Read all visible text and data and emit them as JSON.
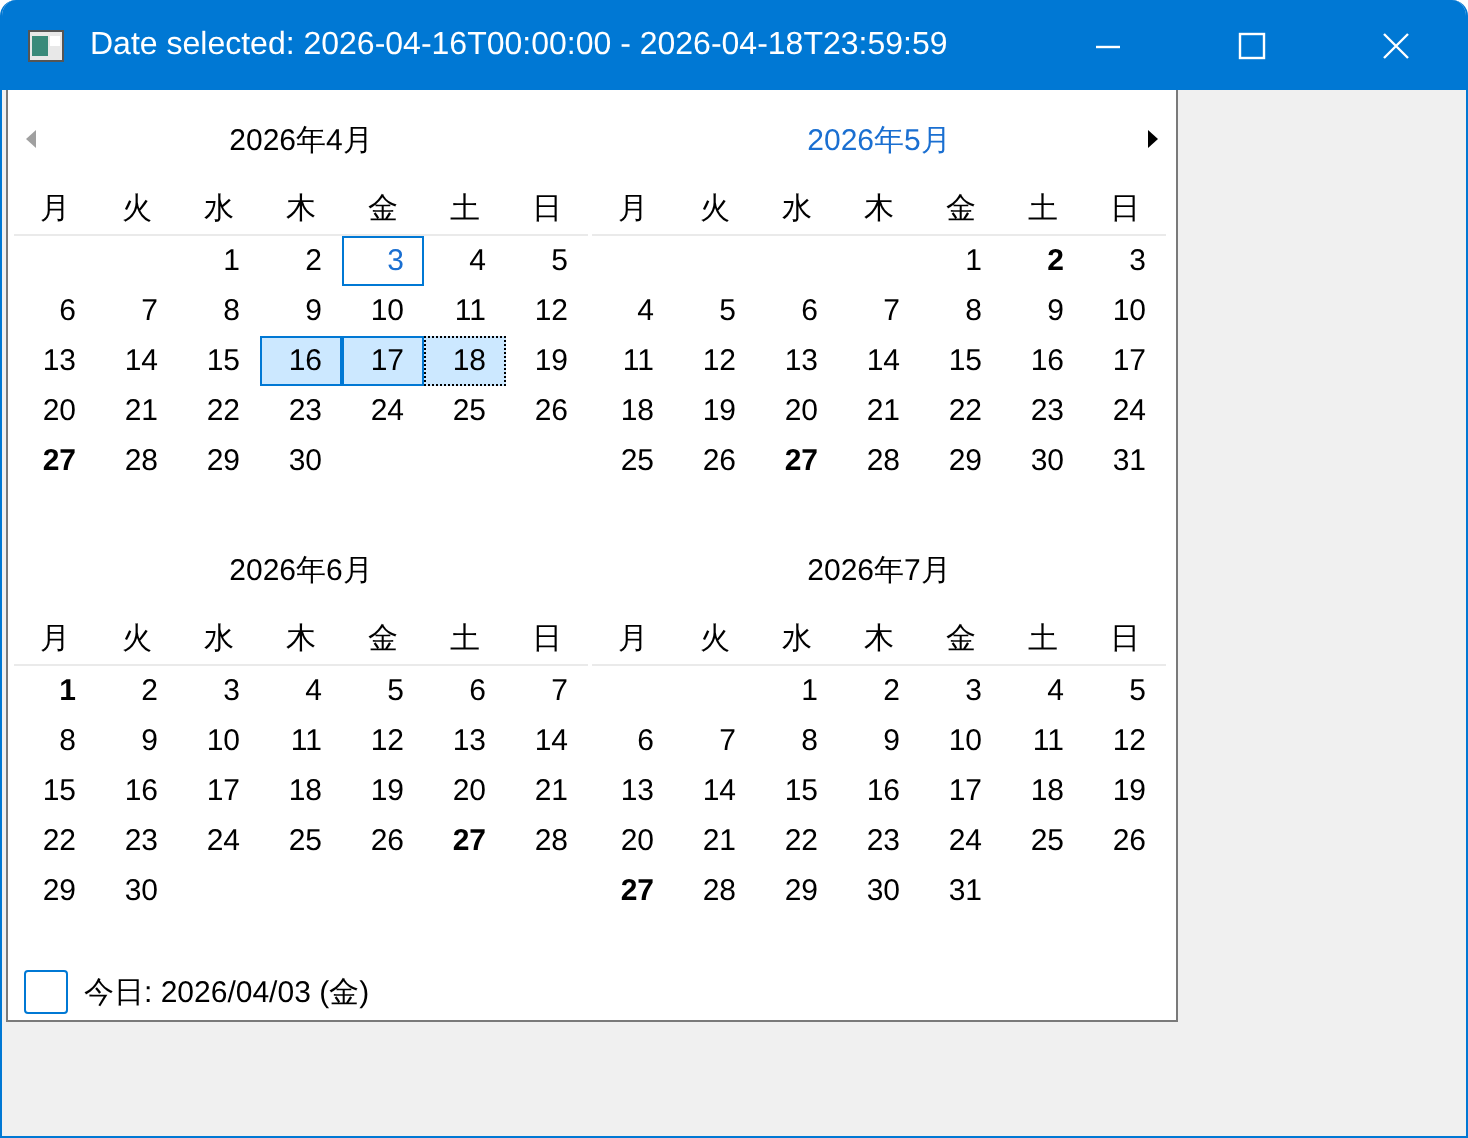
{
  "window": {
    "title": "Date selected: 2026-04-16T00:00:00 - 2026-04-18T23:59:59"
  },
  "months": [
    {
      "title": "2026年4月",
      "highlighted": false,
      "weekdays": [
        "月",
        "火",
        "水",
        "木",
        "金",
        "土",
        "日"
      ],
      "weeks": [
        {
          "kind": "leading",
          "days": [
            {
              "label": "1",
              "bold": false,
              "today": false,
              "selected": false,
              "focused": false
            },
            {
              "label": "2",
              "bold": false,
              "today": false,
              "selected": false,
              "focused": false
            },
            {
              "label": "3",
              "bold": false,
              "today": true,
              "selected": false,
              "focused": false
            },
            {
              "label": "4",
              "bold": false,
              "today": false,
              "selected": false,
              "focused": false
            },
            {
              "label": "5",
              "bold": false,
              "today": false,
              "selected": false,
              "focused": false
            }
          ]
        },
        {
          "kind": "full",
          "days": [
            {
              "label": "6",
              "bold": false,
              "today": false,
              "selected": false,
              "focused": false
            },
            {
              "label": "7",
              "bold": false,
              "today": false,
              "selected": false,
              "focused": false
            },
            {
              "label": "8",
              "bold": false,
              "today": false,
              "selected": false,
              "focused": false
            },
            {
              "label": "9",
              "bold": false,
              "today": false,
              "selected": false,
              "focused": false
            },
            {
              "label": "10",
              "bold": false,
              "today": false,
              "selected": false,
              "focused": false
            },
            {
              "label": "11",
              "bold": false,
              "today": false,
              "selected": false,
              "focused": false
            },
            {
              "label": "12",
              "bold": false,
              "today": false,
              "selected": false,
              "focused": false
            }
          ]
        },
        {
          "kind": "full",
          "days": [
            {
              "label": "13",
              "bold": false,
              "today": false,
              "selected": false,
              "focused": false
            },
            {
              "label": "14",
              "bold": false,
              "today": false,
              "selected": false,
              "focused": false
            },
            {
              "label": "15",
              "bold": false,
              "today": false,
              "selected": false,
              "focused": false
            },
            {
              "label": "16",
              "bold": false,
              "today": false,
              "selected": true,
              "focused": false
            },
            {
              "label": "17",
              "bold": false,
              "today": false,
              "selected": true,
              "focused": false
            },
            {
              "label": "18",
              "bold": false,
              "today": false,
              "selected": true,
              "focused": true
            },
            {
              "label": "19",
              "bold": false,
              "today": false,
              "selected": false,
              "focused": false
            }
          ]
        },
        {
          "kind": "full",
          "days": [
            {
              "label": "20",
              "bold": false,
              "today": false,
              "selected": false,
              "focused": false
            },
            {
              "label": "21",
              "bold": false,
              "today": false,
              "selected": false,
              "focused": false
            },
            {
              "label": "22",
              "bold": false,
              "today": false,
              "selected": false,
              "focused": false
            },
            {
              "label": "23",
              "bold": false,
              "today": false,
              "selected": false,
              "focused": false
            },
            {
              "label": "24",
              "bold": false,
              "today": false,
              "selected": false,
              "focused": false
            },
            {
              "label": "25",
              "bold": false,
              "today": false,
              "selected": false,
              "focused": false
            },
            {
              "label": "26",
              "bold": false,
              "today": false,
              "selected": false,
              "focused": false
            }
          ]
        },
        {
          "kind": "full",
          "days": [
            {
              "label": "27",
              "bold": true,
              "today": false,
              "selected": false,
              "focused": false
            },
            {
              "label": "28",
              "bold": false,
              "today": false,
              "selected": false,
              "focused": false
            },
            {
              "label": "29",
              "bold": false,
              "today": false,
              "selected": false,
              "focused": false
            },
            {
              "label": "30",
              "bold": false,
              "today": false,
              "selected": false,
              "focused": false
            }
          ]
        }
      ]
    },
    {
      "title": "2026年5月",
      "highlighted": true,
      "weekdays": [
        "月",
        "火",
        "水",
        "木",
        "金",
        "土",
        "日"
      ],
      "weeks": [
        {
          "kind": "leading",
          "days": [
            {
              "label": "1",
              "bold": false,
              "today": false,
              "selected": false,
              "focused": false
            },
            {
              "label": "2",
              "bold": true,
              "today": false,
              "selected": false,
              "focused": false
            },
            {
              "label": "3",
              "bold": false,
              "today": false,
              "selected": false,
              "focused": false
            }
          ]
        },
        {
          "kind": "full",
          "days": [
            {
              "label": "4",
              "bold": false,
              "today": false,
              "selected": false,
              "focused": false
            },
            {
              "label": "5",
              "bold": false,
              "today": false,
              "selected": false,
              "focused": false
            },
            {
              "label": "6",
              "bold": false,
              "today": false,
              "selected": false,
              "focused": false
            },
            {
              "label": "7",
              "bold": false,
              "today": false,
              "selected": false,
              "focused": false
            },
            {
              "label": "8",
              "bold": false,
              "today": false,
              "selected": false,
              "focused": false
            },
            {
              "label": "9",
              "bold": false,
              "today": false,
              "selected": false,
              "focused": false
            },
            {
              "label": "10",
              "bold": false,
              "today": false,
              "selected": false,
              "focused": false
            }
          ]
        },
        {
          "kind": "full",
          "days": [
            {
              "label": "11",
              "bold": false,
              "today": false,
              "selected": false,
              "focused": false
            },
            {
              "label": "12",
              "bold": false,
              "today": false,
              "selected": false,
              "focused": false
            },
            {
              "label": "13",
              "bold": false,
              "today": false,
              "selected": false,
              "focused": false
            },
            {
              "label": "14",
              "bold": false,
              "today": false,
              "selected": false,
              "focused": false
            },
            {
              "label": "15",
              "bold": false,
              "today": false,
              "selected": false,
              "focused": false
            },
            {
              "label": "16",
              "bold": false,
              "today": false,
              "selected": false,
              "focused": false
            },
            {
              "label": "17",
              "bold": false,
              "today": false,
              "selected": false,
              "focused": false
            }
          ]
        },
        {
          "kind": "full",
          "days": [
            {
              "label": "18",
              "bold": false,
              "today": false,
              "selected": false,
              "focused": false
            },
            {
              "label": "19",
              "bold": false,
              "today": false,
              "selected": false,
              "focused": false
            },
            {
              "label": "20",
              "bold": false,
              "today": false,
              "selected": false,
              "focused": false
            },
            {
              "label": "21",
              "bold": false,
              "today": false,
              "selected": false,
              "focused": false
            },
            {
              "label": "22",
              "bold": false,
              "today": false,
              "selected": false,
              "focused": false
            },
            {
              "label": "23",
              "bold": false,
              "today": false,
              "selected": false,
              "focused": false
            },
            {
              "label": "24",
              "bold": false,
              "today": false,
              "selected": false,
              "focused": false
            }
          ]
        },
        {
          "kind": "full",
          "days": [
            {
              "label": "25",
              "bold": false,
              "today": false,
              "selected": false,
              "focused": false
            },
            {
              "label": "26",
              "bold": false,
              "today": false,
              "selected": false,
              "focused": false
            },
            {
              "label": "27",
              "bold": true,
              "today": false,
              "selected": false,
              "focused": false
            },
            {
              "label": "28",
              "bold": false,
              "today": false,
              "selected": false,
              "focused": false
            },
            {
              "label": "29",
              "bold": false,
              "today": false,
              "selected": false,
              "focused": false
            },
            {
              "label": "30",
              "bold": false,
              "today": false,
              "selected": false,
              "focused": false
            },
            {
              "label": "31",
              "bold": false,
              "today": false,
              "selected": false,
              "focused": false
            }
          ]
        }
      ]
    },
    {
      "title": "2026年6月",
      "highlighted": false,
      "weekdays": [
        "月",
        "火",
        "水",
        "木",
        "金",
        "土",
        "日"
      ],
      "weeks": [
        {
          "kind": "full",
          "days": [
            {
              "label": "1",
              "bold": true,
              "today": false,
              "selected": false,
              "focused": false
            },
            {
              "label": "2",
              "bold": false,
              "today": false,
              "selected": false,
              "focused": false
            },
            {
              "label": "3",
              "bold": false,
              "today": false,
              "selected": false,
              "focused": false
            },
            {
              "label": "4",
              "bold": false,
              "today": false,
              "selected": false,
              "focused": false
            },
            {
              "label": "5",
              "bold": false,
              "today": false,
              "selected": false,
              "focused": false
            },
            {
              "label": "6",
              "bold": false,
              "today": false,
              "selected": false,
              "focused": false
            },
            {
              "label": "7",
              "bold": false,
              "today": false,
              "selected": false,
              "focused": false
            }
          ]
        },
        {
          "kind": "full",
          "days": [
            {
              "label": "8",
              "bold": false,
              "today": false,
              "selected": false,
              "focused": false
            },
            {
              "label": "9",
              "bold": false,
              "today": false,
              "selected": false,
              "focused": false
            },
            {
              "label": "10",
              "bold": false,
              "today": false,
              "selected": false,
              "focused": false
            },
            {
              "label": "11",
              "bold": false,
              "today": false,
              "selected": false,
              "focused": false
            },
            {
              "label": "12",
              "bold": false,
              "today": false,
              "selected": false,
              "focused": false
            },
            {
              "label": "13",
              "bold": false,
              "today": false,
              "selected": false,
              "focused": false
            },
            {
              "label": "14",
              "bold": false,
              "today": false,
              "selected": false,
              "focused": false
            }
          ]
        },
        {
          "kind": "full",
          "days": [
            {
              "label": "15",
              "bold": false,
              "today": false,
              "selected": false,
              "focused": false
            },
            {
              "label": "16",
              "bold": false,
              "today": false,
              "selected": false,
              "focused": false
            },
            {
              "label": "17",
              "bold": false,
              "today": false,
              "selected": false,
              "focused": false
            },
            {
              "label": "18",
              "bold": false,
              "today": false,
              "selected": false,
              "focused": false
            },
            {
              "label": "19",
              "bold": false,
              "today": false,
              "selected": false,
              "focused": false
            },
            {
              "label": "20",
              "bold": false,
              "today": false,
              "selected": false,
              "focused": false
            },
            {
              "label": "21",
              "bold": false,
              "today": false,
              "selected": false,
              "focused": false
            }
          ]
        },
        {
          "kind": "full",
          "days": [
            {
              "label": "22",
              "bold": false,
              "today": false,
              "selected": false,
              "focused": false
            },
            {
              "label": "23",
              "bold": false,
              "today": false,
              "selected": false,
              "focused": false
            },
            {
              "label": "24",
              "bold": false,
              "today": false,
              "selected": false,
              "focused": false
            },
            {
              "label": "25",
              "bold": false,
              "today": false,
              "selected": false,
              "focused": false
            },
            {
              "label": "26",
              "bold": false,
              "today": false,
              "selected": false,
              "focused": false
            },
            {
              "label": "27",
              "bold": true,
              "today": false,
              "selected": false,
              "focused": false
            },
            {
              "label": "28",
              "bold": false,
              "today": false,
              "selected": false,
              "focused": false
            }
          ]
        },
        {
          "kind": "full",
          "days": [
            {
              "label": "29",
              "bold": false,
              "today": false,
              "selected": false,
              "focused": false
            },
            {
              "label": "30",
              "bold": false,
              "today": false,
              "selected": false,
              "focused": false
            }
          ]
        }
      ]
    },
    {
      "title": "2026年7月",
      "highlighted": false,
      "weekdays": [
        "月",
        "火",
        "水",
        "木",
        "金",
        "土",
        "日"
      ],
      "weeks": [
        {
          "kind": "leading",
          "days": [
            {
              "label": "1",
              "bold": false,
              "today": false,
              "selected": false,
              "focused": false
            },
            {
              "label": "2",
              "bold": false,
              "today": false,
              "selected": false,
              "focused": false
            },
            {
              "label": "3",
              "bold": false,
              "today": false,
              "selected": false,
              "focused": false
            },
            {
              "label": "4",
              "bold": false,
              "today": false,
              "selected": false,
              "focused": false
            },
            {
              "label": "5",
              "bold": false,
              "today": false,
              "selected": false,
              "focused": false
            }
          ]
        },
        {
          "kind": "full",
          "days": [
            {
              "label": "6",
              "bold": false,
              "today": false,
              "selected": false,
              "focused": false
            },
            {
              "label": "7",
              "bold": false,
              "today": false,
              "selected": false,
              "focused": false
            },
            {
              "label": "8",
              "bold": false,
              "today": false,
              "selected": false,
              "focused": false
            },
            {
              "label": "9",
              "bold": false,
              "today": false,
              "selected": false,
              "focused": false
            },
            {
              "label": "10",
              "bold": false,
              "today": false,
              "selected": false,
              "focused": false
            },
            {
              "label": "11",
              "bold": false,
              "today": false,
              "selected": false,
              "focused": false
            },
            {
              "label": "12",
              "bold": false,
              "today": false,
              "selected": false,
              "focused": false
            }
          ]
        },
        {
          "kind": "full",
          "days": [
            {
              "label": "13",
              "bold": false,
              "today": false,
              "selected": false,
              "focused": false
            },
            {
              "label": "14",
              "bold": false,
              "today": false,
              "selected": false,
              "focused": false
            },
            {
              "label": "15",
              "bold": false,
              "today": false,
              "selected": false,
              "focused": false
            },
            {
              "label": "16",
              "bold": false,
              "today": false,
              "selected": false,
              "focused": false
            },
            {
              "label": "17",
              "bold": false,
              "today": false,
              "selected": false,
              "focused": false
            },
            {
              "label": "18",
              "bold": false,
              "today": false,
              "selected": false,
              "focused": false
            },
            {
              "label": "19",
              "bold": false,
              "today": false,
              "selected": false,
              "focused": false
            }
          ]
        },
        {
          "kind": "full",
          "days": [
            {
              "label": "20",
              "bold": false,
              "today": false,
              "selected": false,
              "focused": false
            },
            {
              "label": "21",
              "bold": false,
              "today": false,
              "selected": false,
              "focused": false
            },
            {
              "label": "22",
              "bold": false,
              "today": false,
              "selected": false,
              "focused": false
            },
            {
              "label": "23",
              "bold": false,
              "today": false,
              "selected": false,
              "focused": false
            },
            {
              "label": "24",
              "bold": false,
              "today": false,
              "selected": false,
              "focused": false
            },
            {
              "label": "25",
              "bold": false,
              "today": false,
              "selected": false,
              "focused": false
            },
            {
              "label": "26",
              "bold": false,
              "today": false,
              "selected": false,
              "focused": false
            }
          ]
        },
        {
          "kind": "full",
          "days": [
            {
              "label": "27",
              "bold": true,
              "today": false,
              "selected": false,
              "focused": false
            },
            {
              "label": "28",
              "bold": false,
              "today": false,
              "selected": false,
              "focused": false
            },
            {
              "label": "29",
              "bold": false,
              "today": false,
              "selected": false,
              "focused": false
            },
            {
              "label": "30",
              "bold": false,
              "today": false,
              "selected": false,
              "focused": false
            },
            {
              "label": "31",
              "bold": false,
              "today": false,
              "selected": false,
              "focused": false
            }
          ]
        }
      ]
    }
  ],
  "today_label": "今日: 2026/04/03 (金)"
}
